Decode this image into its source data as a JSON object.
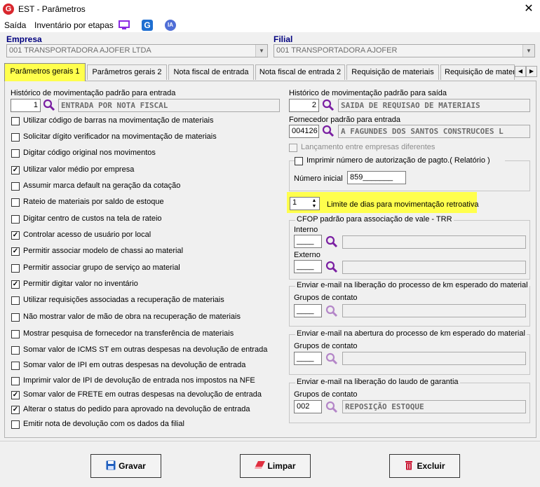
{
  "window": {
    "title": "EST - Parâmetros",
    "logo": "G"
  },
  "menu": {
    "items": [
      {
        "label": "Saída"
      },
      {
        "label": "Inventário por etapas"
      }
    ],
    "icons": [
      "monitor-icon",
      "g-app-icon",
      "ia-icon"
    ],
    "ia_label": "IA",
    "g_label": "G"
  },
  "empresa": {
    "label": "Empresa",
    "value": "001 TRANSPORTADORA AJOFER LTDA"
  },
  "filial": {
    "label": "Filial",
    "value": "001 TRANSPORTADORA AJOFER"
  },
  "tabs": [
    {
      "label": "Parâmetros gerais 1",
      "active": true
    },
    {
      "label": "Parâmetros gerais 2"
    },
    {
      "label": "Nota fiscal de entrada"
    },
    {
      "label": "Nota fiscal de entrada 2"
    },
    {
      "label": "Requisição de materiais"
    },
    {
      "label": "Requisição de materi"
    }
  ],
  "left": {
    "historico_entrada": {
      "label": "Histórico de movimentação padrão para entrada",
      "code": "1",
      "desc": "ENTRADA POR NOTA FISCAL"
    },
    "checkboxes": [
      {
        "label": "Utilizar código de barras na movimentação de materiais",
        "checked": false
      },
      {
        "label": "Solicitar dígito verificador na movimentação de materiais",
        "checked": false
      },
      {
        "label": "Digitar código original nos movimentos",
        "checked": false
      },
      {
        "label": "Utilizar valor médio por empresa",
        "checked": true
      },
      {
        "label": "Assumir marca default na geração da cotação",
        "checked": false
      },
      {
        "label": "Rateio de materiais por saldo de estoque",
        "checked": false
      },
      {
        "label": "Digitar centro de custos na tela de rateio",
        "checked": false
      },
      {
        "label": "Controlar acesso de usuário por local",
        "checked": true
      },
      {
        "label": "Permitir associar modelo de chassi ao material",
        "checked": true
      },
      {
        "label": "Permitir associar grupo de serviço ao material",
        "checked": false
      },
      {
        "label": "Permitir digitar valor no inventário",
        "checked": true
      },
      {
        "label": "Utilizar requisições associadas a recuperação de materiais",
        "checked": false
      },
      {
        "label": "Não mostrar valor de mão de obra na recuperação de materiais",
        "checked": false
      },
      {
        "label": "Mostrar pesquisa de fornecedor na transferência de materiais",
        "checked": false
      },
      {
        "label": "Somar valor de ICMS ST em outras despesas na devolução de entrada",
        "checked": false
      },
      {
        "label": "Somar valor de IPI em outras despesas na devolução de entrada",
        "checked": false
      },
      {
        "label": "Imprimir valor de IPI de devolução de entrada nos impostos na NFE",
        "checked": false
      },
      {
        "label": "Somar valor de FRETE em outras despesas na devolução de entrada",
        "checked": true
      },
      {
        "label": "Alterar o status do pedido para aprovado na devolução de entrada",
        "checked": true
      },
      {
        "label": "Emitir nota de devolução com os dados da filial",
        "checked": false
      }
    ]
  },
  "right": {
    "historico_saida": {
      "label": "Histórico de movimentação padrão para saída",
      "code": "2",
      "desc": "SAIDA DE REQUISAO DE MATERIAIS"
    },
    "fornecedor": {
      "label": "Fornecedor padrão para entrada",
      "code": "004126",
      "desc": "A FAGUNDES DOS SANTOS CONSTRUCOES L"
    },
    "lancamento": {
      "label": "Lançamento entre empresas diferentes",
      "checked": false
    },
    "imprimir_autorizacao": {
      "label": "Imprimir número de autorização de pagto.( Relatório )",
      "checked": false
    },
    "numero_inicial": {
      "label": "Número inicial",
      "value": "859_______"
    },
    "limite": {
      "value": "1",
      "label": "Limite de dias para movimentação retroativa"
    },
    "cfop": {
      "title": "CFOP padrão para associação de vale - TRR",
      "interno_label": "Interno",
      "interno_value": "____",
      "externo_label": "Externo",
      "externo_value": "____"
    },
    "email_km_liberacao": {
      "title": "Enviar e-mail na liberação do processo de km esperado do material",
      "label": "Grupos de contato",
      "value": "____"
    },
    "email_km_abertura": {
      "title": "Enviar e-mail na abertura do processo de km esperado do material",
      "label": "Grupos de contato",
      "value": "____"
    },
    "email_laudo": {
      "title": "Enviar e-mail na liberação do laudo de garantia",
      "label": "Grupos de contato",
      "code": "002",
      "desc": "REPOSIÇÃO ESTOQUE"
    }
  },
  "buttons": {
    "gravar": "Gravar",
    "limpar": "Limpar",
    "excluir": "Excluir"
  },
  "colors": {
    "highlight": "#ffff4d",
    "label_blue": "#00007f",
    "search_purple": "#7a1fa2"
  }
}
